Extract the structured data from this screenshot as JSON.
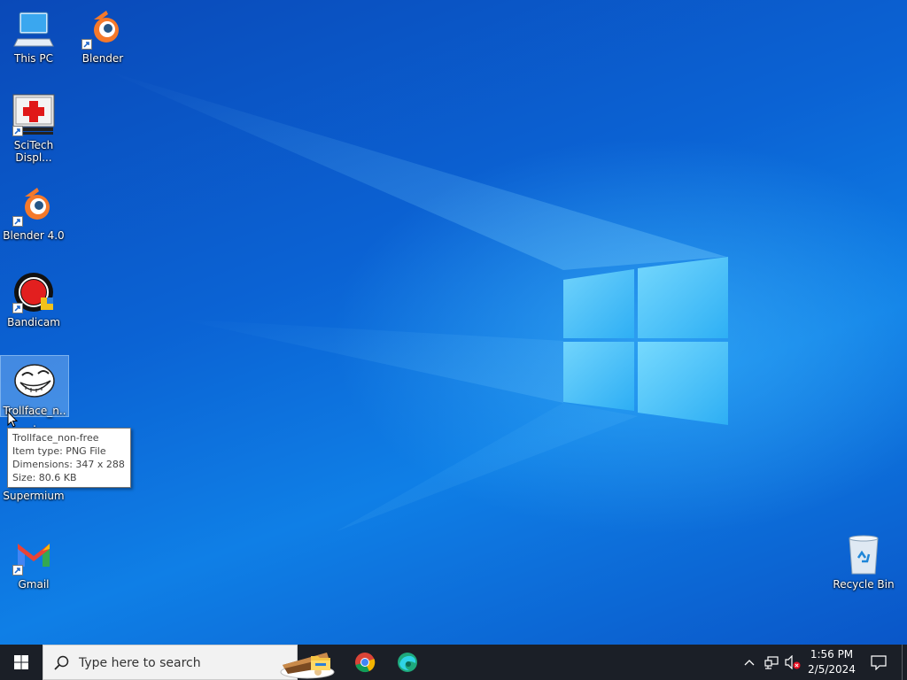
{
  "desktop": {
    "icons": [
      {
        "id": "this-pc",
        "label": "This PC",
        "icon": "computer-icon"
      },
      {
        "id": "blender",
        "label": "Blender",
        "icon": "blender-icon"
      },
      {
        "id": "scitech",
        "label": "SciTech Displ...",
        "icon": "red-cross-icon"
      },
      {
        "id": "blender4",
        "label": "Blender 4.0",
        "icon": "blender-icon"
      },
      {
        "id": "bandicam",
        "label": "Bandicam",
        "icon": "bandicam-icon"
      },
      {
        "id": "trollface",
        "label": "Trollface_n...",
        "icon": "trollface-icon",
        "selected": true
      },
      {
        "id": "supermium",
        "label": "Supermium",
        "icon": "supermium-icon"
      },
      {
        "id": "gmail",
        "label": "Gmail",
        "icon": "gmail-icon"
      },
      {
        "id": "recycle-bin",
        "label": "Recycle Bin",
        "icon": "recycle-bin-icon"
      }
    ]
  },
  "tooltip": {
    "name": "Trollface_non-free",
    "type": "Item type: PNG File",
    "dimensions": "Dimensions: 347 x 288",
    "size": "Size: 80.6 KB"
  },
  "taskbar": {
    "search_placeholder": "Type here to search",
    "apps": [
      "file-explorer-icon",
      "chrome-icon",
      "edge-icon"
    ],
    "clock": {
      "time": "1:56 PM",
      "date": "2/5/2024"
    },
    "tray_icons": [
      "chevron-up-icon",
      "network-icon",
      "volume-muted-icon",
      "notification-icon"
    ]
  },
  "colors": {
    "taskbar": "#1b1f27",
    "desktop_accent": "#0b63d4",
    "search_bg": "#f2f2f2"
  }
}
